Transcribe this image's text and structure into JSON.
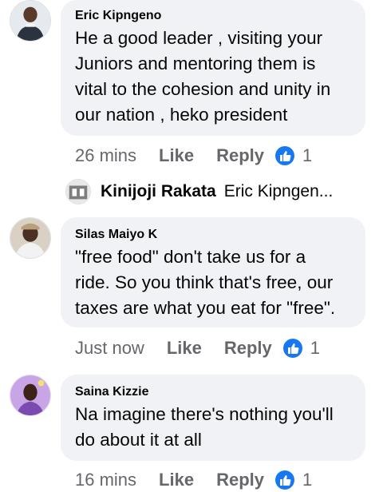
{
  "comments": [
    {
      "author": "Eric Kipngeno",
      "lines": [
        "He a good leader , visiting your",
        "Juniors and mentoring them is",
        "vital to the cohesion and unity in",
        "our nation , heko president"
      ],
      "time": "26 mins",
      "like_label": "Like",
      "reply_label": "Reply",
      "reaction_count": "1"
    },
    {
      "author": "Silas Maiyo K",
      "lines": [
        "\"free food\" don't take us for a",
        "ride. So you think that's free, our",
        "taxes are what you eat for \"free\"."
      ],
      "time": "Just now",
      "like_label": "Like",
      "reply_label": "Reply",
      "reaction_count": "1"
    },
    {
      "author": "Saina Kizzie",
      "lines": [
        "Na imagine there's nothing you'll",
        "do about it at all"
      ],
      "time": "16 mins",
      "like_label": "Like",
      "reply_label": "Reply",
      "reaction_count": "1"
    }
  ],
  "reply_preview": {
    "author": "Kinijoji Rakata",
    "text": "Eric Kipngen..."
  },
  "colors": {
    "bubble": "#f0f2f5",
    "meta_text": "#65676b",
    "like_badge": "#1877f2"
  },
  "icons": {
    "reaction": "thumbs-up-icon"
  }
}
